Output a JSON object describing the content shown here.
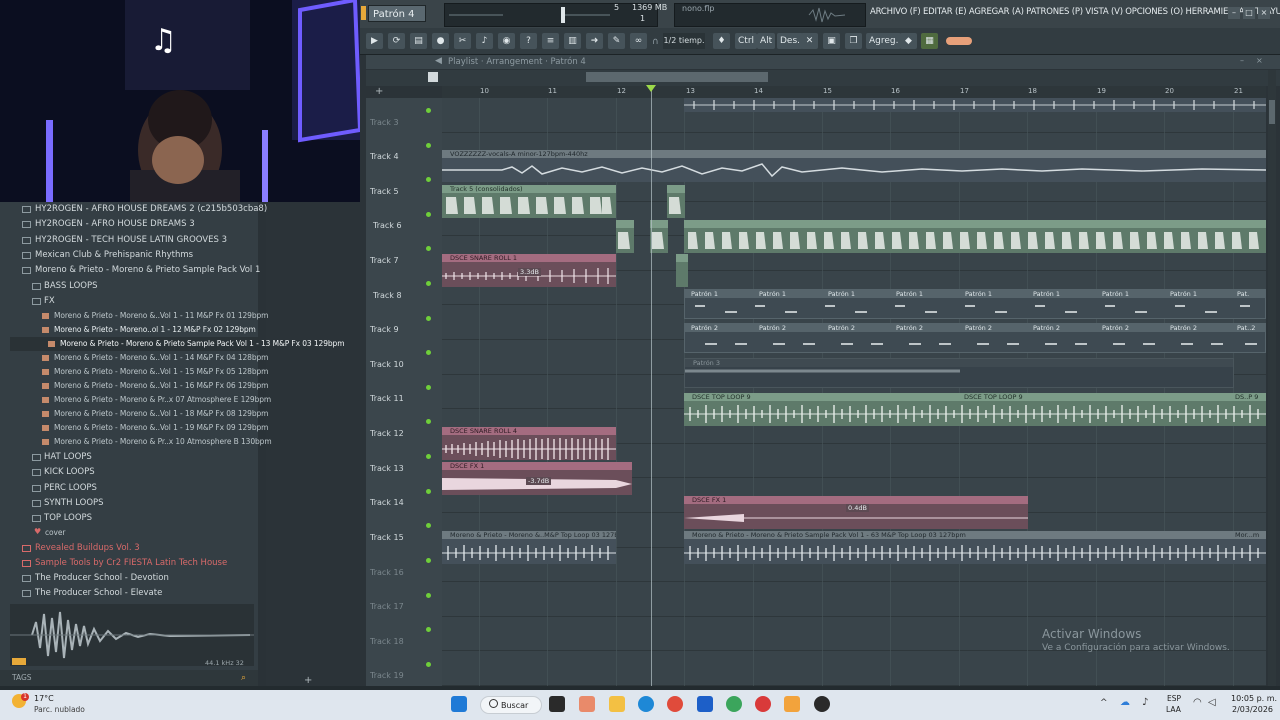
{
  "topbar": {
    "pattern": "Patrón 4",
    "cpu": "5",
    "memory": "1369 MB",
    "voices": "1",
    "hint": "nono.flp",
    "menu": "ARCHIVO (F) EDITAR (E) AGREGAR (A) PATRONES (P) VISTA (V) OPCIONES (O) HERRAMIENTAS (T) AYUDA"
  },
  "toolbar": {
    "snap": "1/2 tiemp.",
    "ctrl": "Ctrl",
    "alt": "Alt",
    "des": "Des.",
    "agreg": "Agreg."
  },
  "playlist": {
    "title": "Playlist · Arrangement · Patrón 4",
    "ruler": [
      "10",
      "11",
      "12",
      "13",
      "14",
      "15",
      "16",
      "17",
      "18",
      "19",
      "20",
      "21"
    ],
    "tracks": [
      "Track 3",
      "Track 4",
      "Track 5",
      "Track 6",
      "Track 7",
      "Track 8",
      "Track 9",
      "Track 10",
      "Track 11",
      "Track 12",
      "Track 13",
      "Track 14",
      "Track 15",
      "Track 16",
      "Track 17",
      "Track 18",
      "Track 19"
    ],
    "clips": {
      "vocals": "VOZZZZZZ-vocals-A minor-127bpm-440hz",
      "track5": "Track 5 (consolidados)",
      "snare1": "DSCE SNARE ROLL 1",
      "snare1_gain": "3.3dB",
      "patron1": "Patrón 1",
      "patron1_short": "Pat.",
      "patron2": "Patrón 2",
      "patron2_short": "Pat..2",
      "patron3": "Patrón 3",
      "toploop": "DSCE TOP LOOP 9",
      "toploop_short": "DS..P 9",
      "snare4": "DSCE SNARE ROLL 4",
      "fx1": "DSCE FX 1",
      "fx1_gain": "-3.7dB",
      "fx1b": "DSCE FX 1",
      "fx1b_gain": "0.4dB",
      "mp_short": "Moreno & Prieto - Moreno &..M&P Top Loop 03 127bpm",
      "mp_long": "Moreno & Prieto - Moreno & Prieto Sample Pack Vol 1 - 63 M&P Top Loop 03 127bpm",
      "mp_end": "Mor...m"
    }
  },
  "browser": {
    "folders": [
      "HY2ROGEN - AFRO HOUSE DREAMS 2 (c215b503cba8)",
      "HY2ROGEN - AFRO HOUSE DREAMS 3",
      "HY2ROGEN - TECH HOUSE LATIN GROOVES 3",
      "Mexican Club & Prehispanic Rhythms",
      "Moreno & Prieto - Moreno & Prieto Sample Pack Vol 1"
    ],
    "sub_top": [
      "BASS LOOPS",
      "FX"
    ],
    "files": [
      "Moreno & Prieto - Moreno &..Vol 1 - 11 M&P Fx 01 129bpm",
      "Moreno & Prieto - Moreno..ol 1 - 12 M&P Fx 02 129bpm",
      "Moreno & Prieto - Moreno & Prieto Sample Pack Vol 1 - 13 M&P Fx 03 129bpm",
      "Moreno & Prieto - Moreno &..Vol 1 - 14 M&P Fx 04 128bpm",
      "Moreno & Prieto - Moreno &..Vol 1 - 15 M&P Fx 05 128bpm",
      "Moreno & Prieto - Moreno &..Vol 1 - 16 M&P Fx 06 129bpm",
      "Moreno & Prieto - Moreno & Pr..x 07 Atmosphere E 129bpm",
      "Moreno & Prieto - Moreno &..Vol 1 - 18 M&P Fx 08 129bpm",
      "Moreno & Prieto - Moreno &..Vol 1 - 19 M&P Fx 09 129bpm",
      "Moreno & Prieto - Moreno & Pr..x 10 Atmosphere B 130bpm"
    ],
    "sub_bottom": [
      "HAT LOOPS",
      "KICK LOOPS",
      "PERC LOOPS",
      "SYNTH LOOPS",
      "TOP LOOPS"
    ],
    "cover": "cover",
    "red_folders": [
      "Revealed Buildups Vol. 3",
      "Sample Tools by Cr2 FIESTA Latin Tech House"
    ],
    "more_folders": [
      "The Producer School - Devotion",
      "The Producer School - Elevate"
    ],
    "preview_info": "44.1 kHz 32",
    "tags": "TAGS"
  },
  "watermark": {
    "line1": "Activar Windows",
    "line2": "Ve a Configuración para activar Windows."
  },
  "taskbar": {
    "temp": "17°C",
    "weather": "Parc. nublado",
    "badge": "1",
    "search": "Buscar",
    "lang1": "ESP",
    "lang2": "LAA",
    "time": "10:05 p. m.",
    "date": "2/03/2026"
  },
  "colors": {
    "accent_green": "#6fcf3a",
    "clip_green": "#7c9c88",
    "clip_pink": "#a46c80",
    "webcam_neon": "#6f5cff"
  }
}
